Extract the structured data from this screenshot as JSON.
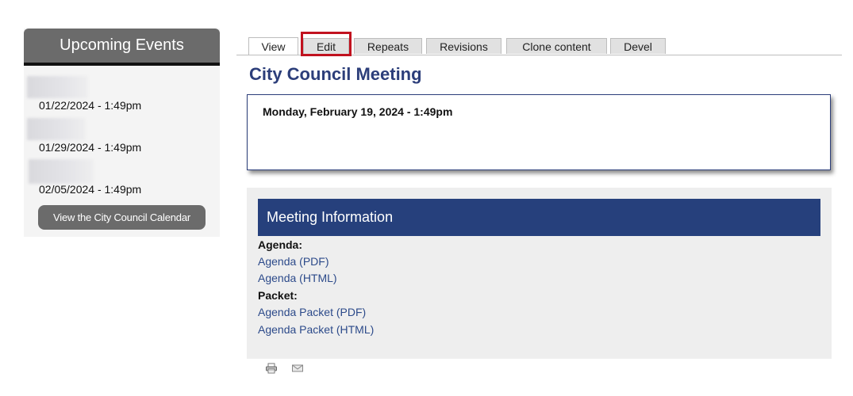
{
  "sidebar": {
    "title": "Upcoming Events",
    "events": [
      {
        "date": "01/22/2024 - 1:49pm"
      },
      {
        "date": "01/29/2024 - 1:49pm"
      },
      {
        "date": "02/05/2024 - 1:49pm"
      }
    ],
    "calendar_button": "View the City Council Calendar"
  },
  "tabs": [
    {
      "label": "View",
      "active": true
    },
    {
      "label": "Edit",
      "active": false
    },
    {
      "label": "Repeats",
      "active": false
    },
    {
      "label": "Revisions",
      "active": false
    },
    {
      "label": "Clone content",
      "active": false
    },
    {
      "label": "Devel",
      "active": false
    }
  ],
  "page": {
    "title": "City Council Meeting",
    "date": "Monday, February 19, 2024 - 1:49pm"
  },
  "meeting_info": {
    "header": "Meeting Information",
    "agenda_label": "Agenda:",
    "agenda_links": [
      "Agenda (PDF)",
      "Agenda (HTML)"
    ],
    "packet_label": "Packet:",
    "packet_links": [
      "Agenda Packet (PDF)",
      "Agenda Packet (HTML)"
    ]
  },
  "footer_icons": [
    "print-icon",
    "email-icon"
  ],
  "colors": {
    "title_blue": "#2c3e7a",
    "header_blue": "#26407c",
    "highlight_red": "#c1121f",
    "sidebar_gray": "#6b6b6b"
  }
}
